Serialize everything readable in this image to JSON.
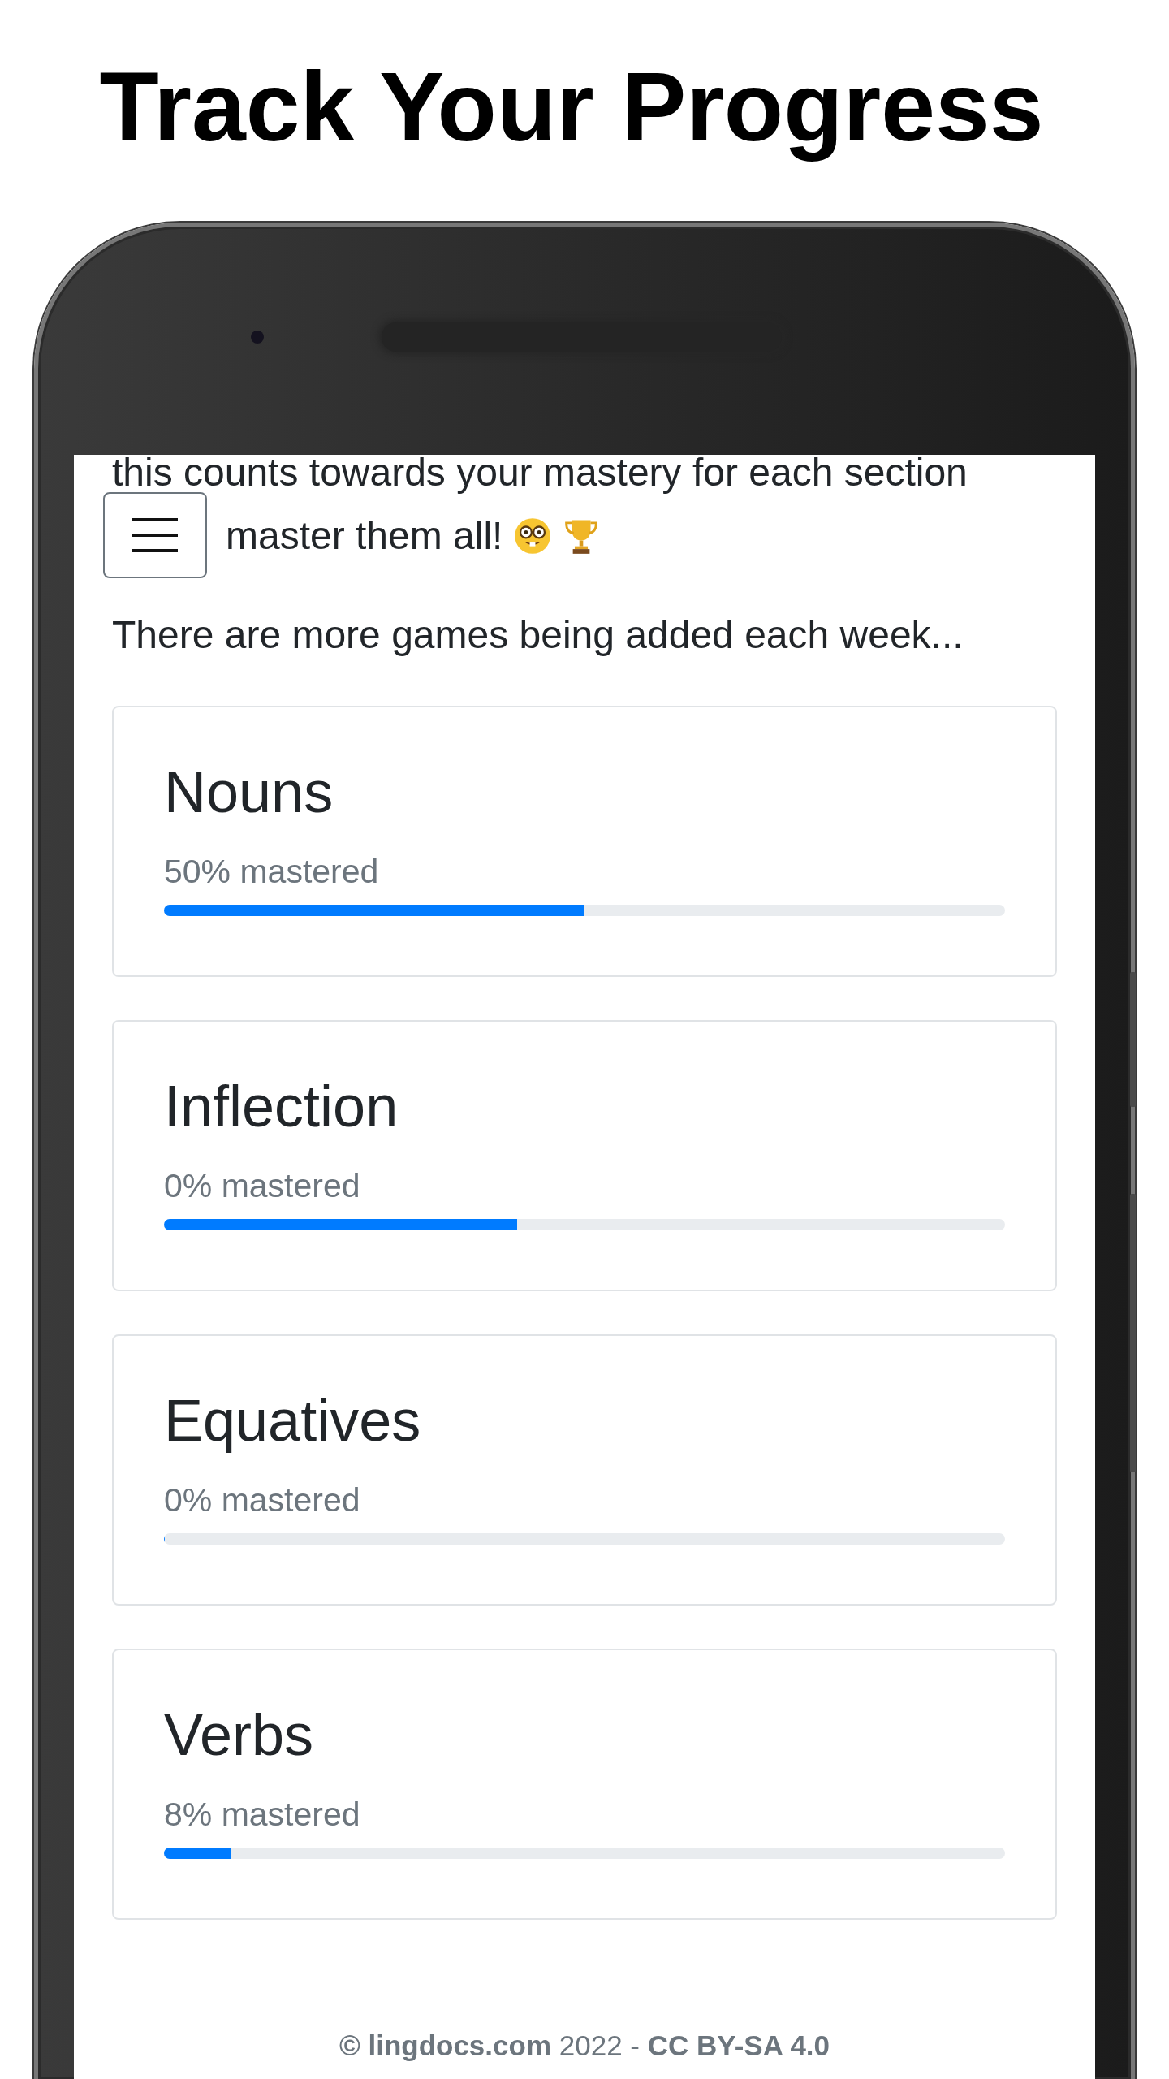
{
  "title": "Track Your Progress",
  "intro": {
    "lines": [
      "this counts towards your mastery for each section",
      "master them all!"
    ]
  },
  "note": "There are more games being added each week...",
  "sections": [
    {
      "name": "Nouns",
      "mastery": "50% mastered",
      "level": 0.5
    },
    {
      "name": "Inflection",
      "mastery": "0% mastered",
      "level": 0.42
    },
    {
      "name": "Equatives",
      "mastery": "0% mastered",
      "level": 0
    },
    {
      "name": "Verbs",
      "mastery": "8% mastered",
      "level": 0.08
    }
  ],
  "footer": "**© lingdocs.com** 2022 - **CC BY-SA 4.0**"
}
